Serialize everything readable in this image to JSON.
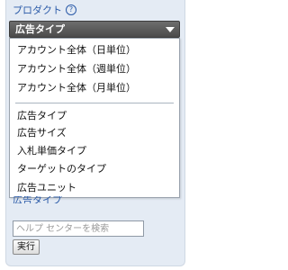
{
  "header": {
    "title": "プロダクト",
    "help_icon": "question-circle-icon"
  },
  "select": {
    "selected": "広告タイプ",
    "arrow_icon": "chevron-down-icon"
  },
  "dropdown": {
    "options": [
      "アカウント全体（日単位）",
      "アカウント全体（週単位）",
      "アカウント全体（月単位）",
      "広告タイプ",
      "広告サイズ",
      "入札単価タイプ",
      "ターゲットのタイプ",
      "広告ユニット"
    ]
  },
  "below_link": "広告タイプ",
  "search": {
    "placeholder": "ヘルプ センターを検索",
    "value": ""
  },
  "run_button": "実行",
  "colors": {
    "panel_bg": "#e4ebf4",
    "link": "#2a5aa8",
    "select_bg": "#5a5a5a"
  }
}
